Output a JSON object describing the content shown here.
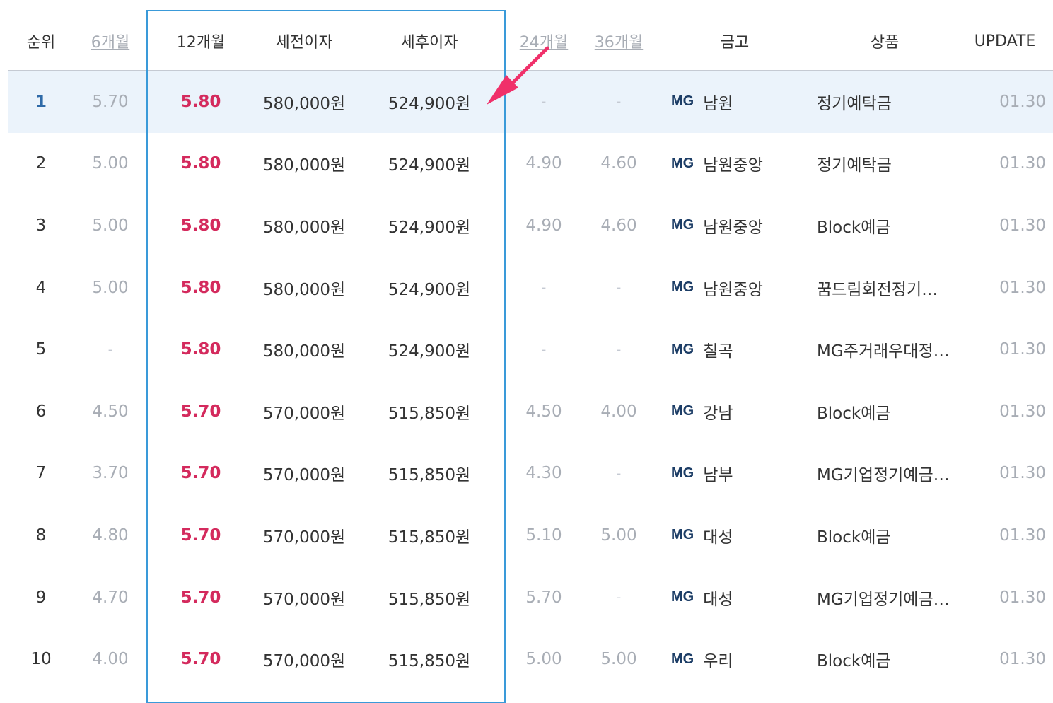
{
  "header": {
    "rank": "순위",
    "m6": "6개월",
    "m12": "12개월",
    "pretax": "세전이자",
    "posttax": "세후이자",
    "m24": "24개월",
    "m36": "36개월",
    "bank": "금고",
    "product": "상품",
    "update": "UPDATE"
  },
  "highlight_row": 1,
  "rows": [
    {
      "rank": "1",
      "m6": "5.70",
      "m12": "5.80",
      "pretax": "580,000원",
      "posttax": "524,900원",
      "m24": "-",
      "m36": "-",
      "mg": "MG",
      "bank": "남원",
      "product": "정기예탁금",
      "update": "01.30"
    },
    {
      "rank": "2",
      "m6": "5.00",
      "m12": "5.80",
      "pretax": "580,000원",
      "posttax": "524,900원",
      "m24": "4.90",
      "m36": "4.60",
      "mg": "MG",
      "bank": "남원중앙",
      "product": "정기예탁금",
      "update": "01.30"
    },
    {
      "rank": "3",
      "m6": "5.00",
      "m12": "5.80",
      "pretax": "580,000원",
      "posttax": "524,900원",
      "m24": "4.90",
      "m36": "4.60",
      "mg": "MG",
      "bank": "남원중앙",
      "product": "Block예금",
      "update": "01.30"
    },
    {
      "rank": "4",
      "m6": "5.00",
      "m12": "5.80",
      "pretax": "580,000원",
      "posttax": "524,900원",
      "m24": "-",
      "m36": "-",
      "mg": "MG",
      "bank": "남원중앙",
      "product": "꿈드림회전정기…",
      "update": "01.30"
    },
    {
      "rank": "5",
      "m6": "-",
      "m12": "5.80",
      "pretax": "580,000원",
      "posttax": "524,900원",
      "m24": "-",
      "m36": "-",
      "mg": "MG",
      "bank": "칠곡",
      "product": "MG주거래우대정…",
      "update": "01.30"
    },
    {
      "rank": "6",
      "m6": "4.50",
      "m12": "5.70",
      "pretax": "570,000원",
      "posttax": "515,850원",
      "m24": "4.50",
      "m36": "4.00",
      "mg": "MG",
      "bank": "강남",
      "product": "Block예금",
      "update": "01.30"
    },
    {
      "rank": "7",
      "m6": "3.70",
      "m12": "5.70",
      "pretax": "570,000원",
      "posttax": "515,850원",
      "m24": "4.30",
      "m36": "-",
      "mg": "MG",
      "bank": "남부",
      "product": "MG기업정기예금…",
      "update": "01.30"
    },
    {
      "rank": "8",
      "m6": "4.80",
      "m12": "5.70",
      "pretax": "570,000원",
      "posttax": "515,850원",
      "m24": "5.10",
      "m36": "5.00",
      "mg": "MG",
      "bank": "대성",
      "product": "Block예금",
      "update": "01.30"
    },
    {
      "rank": "9",
      "m6": "4.70",
      "m12": "5.70",
      "pretax": "570,000원",
      "posttax": "515,850원",
      "m24": "5.70",
      "m36": "-",
      "mg": "MG",
      "bank": "대성",
      "product": "MG기업정기예금…",
      "update": "01.30"
    },
    {
      "rank": "10",
      "m6": "4.00",
      "m12": "5.70",
      "pretax": "570,000원",
      "posttax": "515,850원",
      "m24": "5.00",
      "m36": "5.00",
      "mg": "MG",
      "bank": "우리",
      "product": "Block예금",
      "update": "01.30"
    }
  ],
  "colors": {
    "rate_highlight": "#d42a5d",
    "frame": "#3a9ad9",
    "arrow": "#f0306a",
    "row_highlight_bg": "#ebf3fb",
    "mg_logo": "#1c3d66"
  },
  "icons": {
    "annotation": "arrow-annotation-icon",
    "logo": "mg-logo-icon"
  }
}
